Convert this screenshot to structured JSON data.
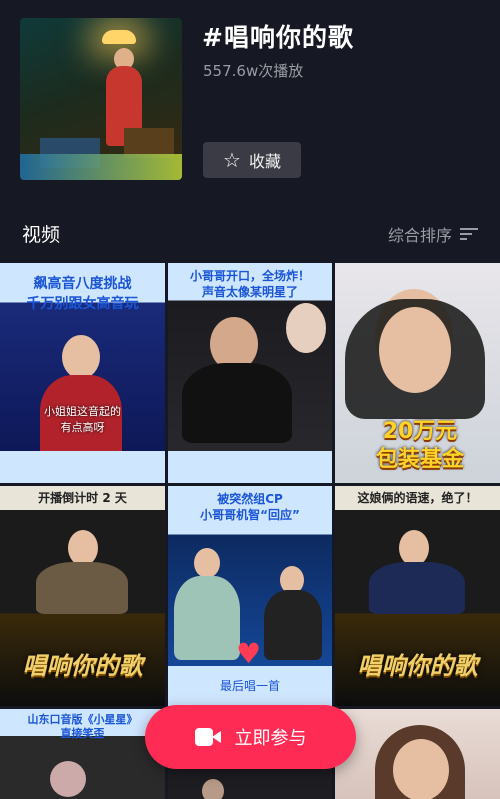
{
  "header": {
    "tag_title": "#唱响你的歌",
    "play_count": "557.6w次播放",
    "favorite_label": "收藏"
  },
  "section": {
    "title": "视频",
    "sort_label": "综合排序"
  },
  "videos": [
    {
      "caption_top": "飙高音八度挑战",
      "caption_bottom": "千万别跟女高音玩",
      "subtitle": "小姐姐这音起的",
      "subtitle2": "有点高呀"
    },
    {
      "caption_top": "小哥哥开口，全场炸！",
      "caption_bottom": "声音太像某明星了"
    },
    {
      "overlay_line1": "20万元",
      "overlay_line2": "包装基金"
    },
    {
      "top_text": "开播倒计时 2 天",
      "logo_text": "唱响你的歌"
    },
    {
      "caption_top": "被突然组CP",
      "caption_bottom": "小哥哥机智“回应”",
      "bottom_text": "最后唱一首"
    },
    {
      "top_text": "这娘俩的语速，绝了！",
      "logo_text": "唱响你的歌"
    },
    {
      "caption_top": "山东口音版《小星星》",
      "caption_bottom": "直接笑歪"
    },
    {},
    {}
  ],
  "cta": {
    "label": "立即参与"
  },
  "colors": {
    "background": "#161823",
    "accent": "#fe2c55",
    "button_bg": "#3a3b44",
    "muted_text": "#9a9ba3"
  }
}
